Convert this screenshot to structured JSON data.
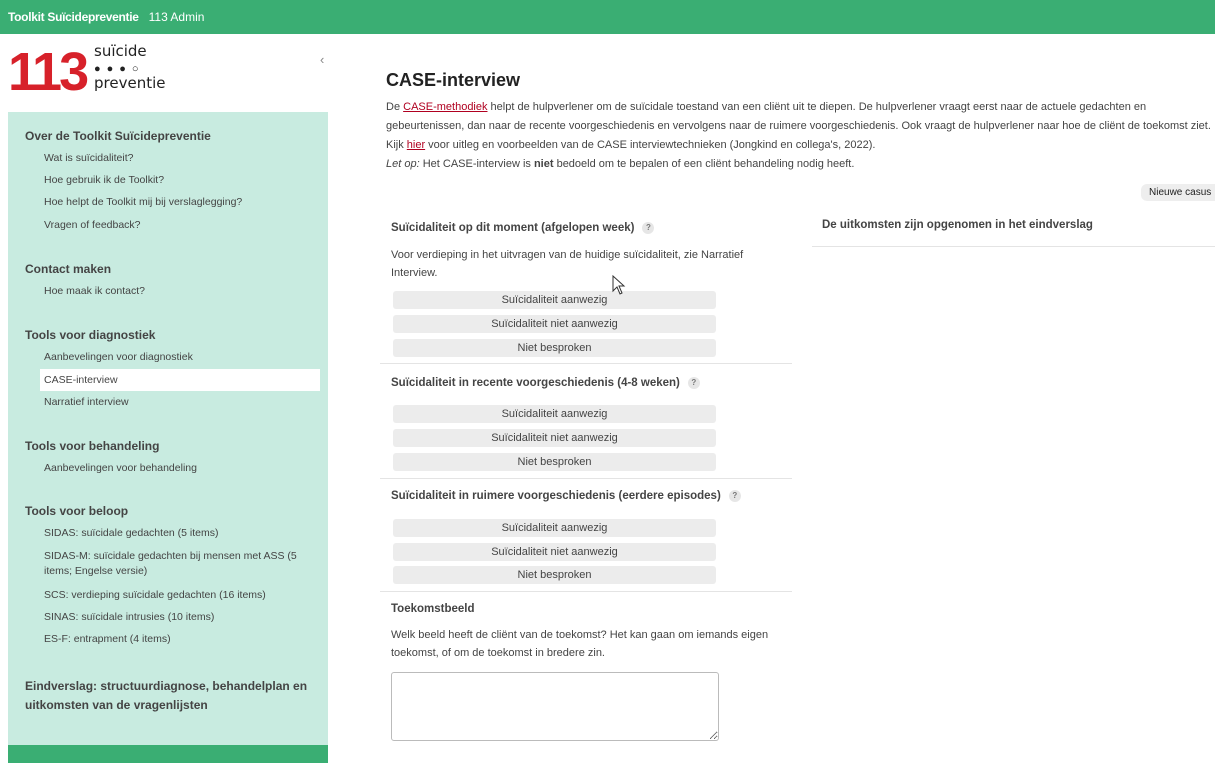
{
  "topbar": {
    "brand": "Toolkit Suïcidepreventie",
    "user": "113 Admin"
  },
  "logo": {
    "number": "113",
    "word1": "suïcide",
    "dots": "●●●○",
    "word2": "preventie"
  },
  "sidebar": {
    "collapse_icon": "‹",
    "sections": [
      {
        "title": "Over de Toolkit Suïcidepreventie",
        "items": [
          "Wat is suïcidaliteit?",
          "Hoe gebruik ik de Toolkit?",
          "Hoe helpt de Toolkit mij bij verslaglegging?",
          "Vragen of feedback?"
        ]
      },
      {
        "title": "Contact maken",
        "items": [
          "Hoe maak ik contact?"
        ]
      },
      {
        "title": "Tools voor diagnostiek",
        "items": [
          "Aanbevelingen voor diagnostiek",
          "CASE-interview",
          "Narratief interview"
        ]
      },
      {
        "title": "Tools voor behandeling",
        "items": [
          "Aanbevelingen voor behandeling"
        ]
      },
      {
        "title": "Tools voor beloop",
        "items": [
          "SIDAS: suïcidale gedachten (5 items)",
          "SIDAS-M: suïcidale gedachten bij mensen met ASS (5 items; Engelse versie)",
          "SCS: verdieping suïcidale gedachten (16 items)",
          "SINAS: suïcidale intrusies (10 items)",
          "ES-F: entrapment (4 items)"
        ]
      },
      {
        "title": "Eindverslag: structuurdiagnose, behandelplan en uitkomsten van de vragenlijsten",
        "items": []
      }
    ]
  },
  "main": {
    "title": "CASE-interview",
    "intro_pre": "De ",
    "intro_link1": "CASE-methodiek",
    "intro_mid": " helpt de hulpverlener om de suïcidale toestand van een cliënt uit te diepen. De hulpverlener vraagt eerst naar de actuele gedachten en gebeurtenissen, dan naar de recente voorgeschiedenis en vervolgens naar de ruimere voorgeschiedenis. Ook vraagt de hulpverlener naar hoe de cliënt de toekomst ziet. Kijk ",
    "intro_link2": "hier",
    "intro_post": " voor uitleg en voorbeelden van de CASE interviewtechnieken (Jongkind en collega's, 2022).",
    "note_label": "Let op:",
    "note_pre": " Het CASE-interview is ",
    "note_bold": "niet",
    "note_post": " bedoeld om te bepalen of een cliënt behandeling nodig heeft.",
    "new_case_button": "Nieuwe casus",
    "help_icon": "?",
    "q1": {
      "title": "Suïcidaliteit op dit moment (afgelopen week)",
      "desc": "Voor verdieping in het uitvragen van de huidige suïcidaliteit, zie Narratief Interview."
    },
    "q2": {
      "title": "Suïcidaliteit in recente voorgeschiedenis (4-8 weken)"
    },
    "q3": {
      "title": "Suïcidaliteit in ruimere voorgeschiedenis (eerdere episodes)"
    },
    "options": [
      "Suïcidaliteit aanwezig",
      "Suïcidaliteit niet aanwezig",
      "Niet besproken"
    ],
    "q4": {
      "title": "Toekomstbeeld",
      "desc": "Welk beeld heeft de cliënt van de toekomst? Het kan gaan om iemands eigen toekomst, of om de toekomst in bredere zin.",
      "value": ""
    },
    "outcome": "De uitkomsten zijn opgenomen in het eindverslag"
  },
  "colors": {
    "topbar": "#3aae73",
    "sidebar": "#c8ebe0",
    "logo_red": "#d7212a",
    "link": "#b00020"
  }
}
